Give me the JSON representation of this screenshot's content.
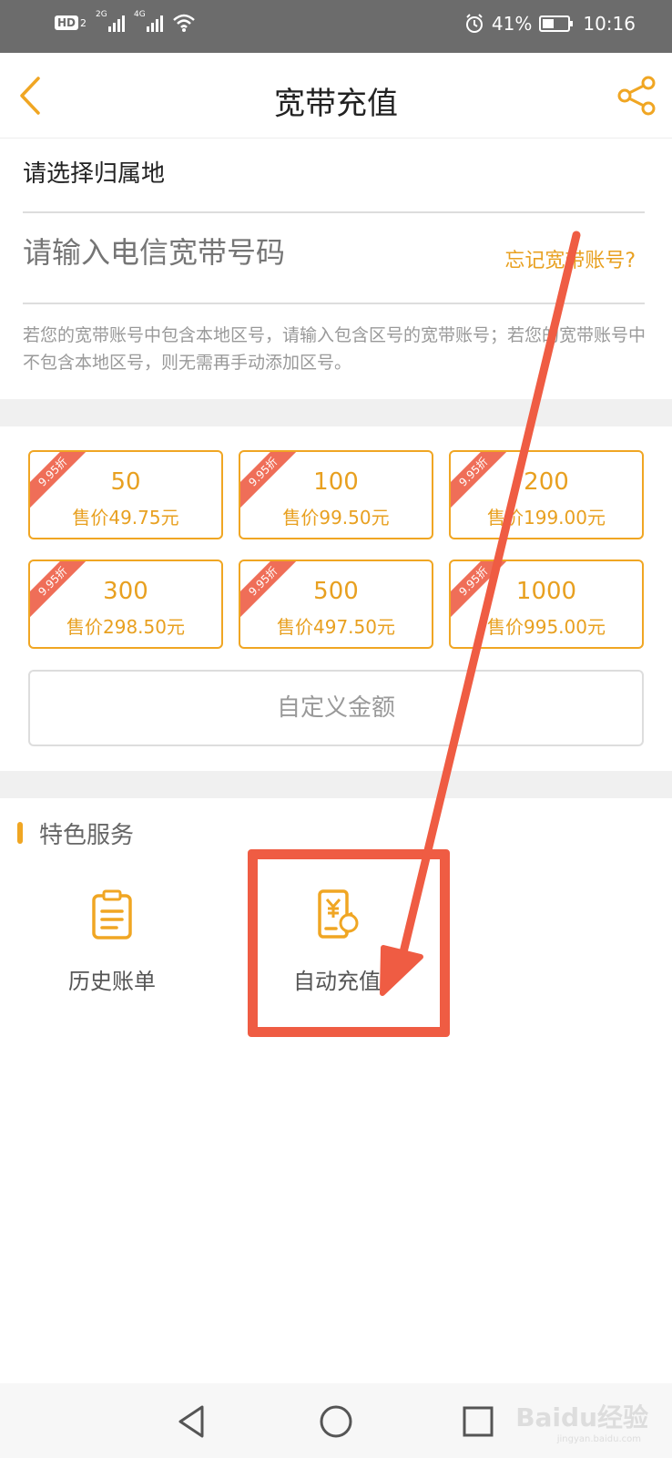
{
  "status_bar": {
    "hd": "HD",
    "hd_sub": "2",
    "net1": "2G",
    "net2": "4G",
    "battery": "41%",
    "time": "10:16"
  },
  "header": {
    "title": "宽带充值"
  },
  "form": {
    "region_label": "请选择归属地",
    "account_placeholder": "请输入电信宽带号码",
    "forgot_link": "忘记宽带账号?",
    "hint": "若您的宽带账号中包含本地区号，请输入包含区号的宽带账号；若您的宽带账号中不包含本地区号，则无需再手动添加区号。"
  },
  "amounts": [
    {
      "discount": "9.95折",
      "value": "50",
      "price": "售价49.75元"
    },
    {
      "discount": "9.95折",
      "value": "100",
      "price": "售价99.50元"
    },
    {
      "discount": "9.95折",
      "value": "200",
      "price": "售价199.00元"
    },
    {
      "discount": "9.95折",
      "value": "300",
      "price": "售价298.50元"
    },
    {
      "discount": "9.95折",
      "value": "500",
      "price": "售价497.50元"
    },
    {
      "discount": "9.95折",
      "value": "1000",
      "price": "售价995.00元"
    }
  ],
  "custom_amount_label": "自定义金额",
  "featured": {
    "title": "特色服务",
    "items": [
      {
        "label": "历史账单",
        "icon": "clipboard-icon"
      },
      {
        "label": "自动充值",
        "icon": "auto-recharge-icon"
      }
    ]
  },
  "watermark": {
    "text": "Baidu经验",
    "sub": "jingyan.baidu.com"
  },
  "colors": {
    "accent": "#f0a623",
    "annotation": "#ef5c43",
    "statusbar": "#6c6c6c"
  }
}
